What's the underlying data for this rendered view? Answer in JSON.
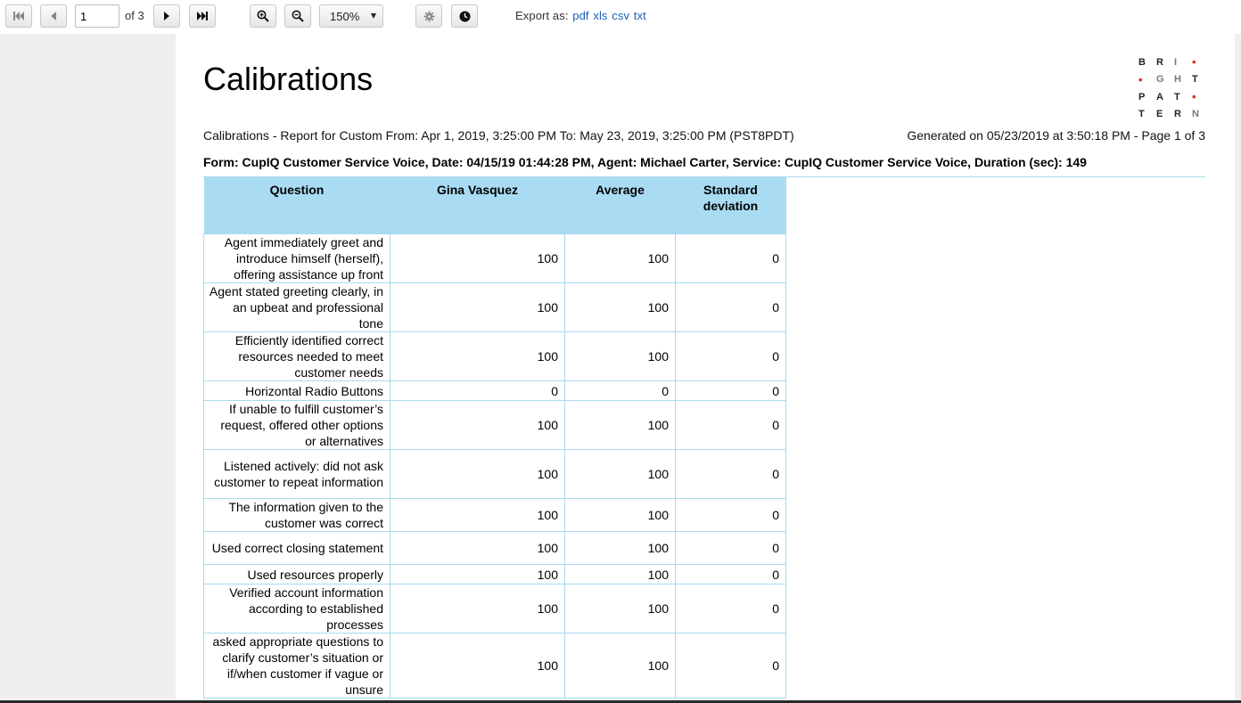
{
  "toolbar": {
    "page_value": "1",
    "of_text": "of 3",
    "zoom": "150%",
    "export_label": "Export as:",
    "export_formats": [
      "pdf",
      "xls",
      "csv",
      "txt"
    ]
  },
  "report": {
    "title": "Calibrations",
    "subtitle": "Calibrations - Report for Custom From: Apr 1, 2019, 3:25:00 PM To: May 23, 2019, 3:25:00 PM (PST8PDT)",
    "generated": "Generated on 05/23/2019 at 3:50:18 PM - Page 1 of 3",
    "form_line": "Form: CupIQ Customer Service Voice, Date: 04/15/19 01:44:28 PM, Agent: Michael Carter, Service: CupIQ Customer Service Voice, Duration (sec): 149"
  },
  "logo": {
    "rows": [
      [
        "B",
        "R",
        "I",
        "•"
      ],
      [
        "•",
        "G",
        "H",
        "T"
      ],
      [
        "P",
        "A",
        "T",
        "•"
      ],
      [
        "T",
        "E",
        "R",
        "N"
      ]
    ]
  },
  "table": {
    "headers": [
      "Question",
      "Gina Vasquez",
      "Average",
      "Standard deviation"
    ],
    "rows": [
      {
        "question": "Agent immediately greet and introduce himself (herself), offering assistance up front",
        "gina": "100",
        "average": "100",
        "stddev": "0"
      },
      {
        "question": "Agent stated greeting clearly, in an upbeat and professional tone",
        "gina": "100",
        "average": "100",
        "stddev": "0"
      },
      {
        "question": "Efficiently identified correct resources needed to meet customer needs",
        "gina": "100",
        "average": "100",
        "stddev": "0"
      },
      {
        "question": "Horizontal Radio Buttons",
        "gina": "0",
        "average": "0",
        "stddev": "0"
      },
      {
        "question": "If unable to fulfill customer’s request, offered other options or alternatives",
        "gina": "100",
        "average": "100",
        "stddev": "0"
      },
      {
        "question": "Listened actively: did not ask customer to repeat information",
        "gina": "100",
        "average": "100",
        "stddev": "0"
      },
      {
        "question": "The information given to the customer was correct",
        "gina": "100",
        "average": "100",
        "stddev": "0"
      },
      {
        "question": "Used correct closing statement",
        "gina": "100",
        "average": "100",
        "stddev": "0"
      },
      {
        "question": "Used resources properly",
        "gina": "100",
        "average": "100",
        "stddev": "0"
      },
      {
        "question": "Verified account information according to established processes",
        "gina": "100",
        "average": "100",
        "stddev": "0"
      },
      {
        "question": "asked appropriate questions to clarify customer’s situation or if/when customer if vague or unsure",
        "gina": "100",
        "average": "100",
        "stddev": "0"
      }
    ]
  }
}
